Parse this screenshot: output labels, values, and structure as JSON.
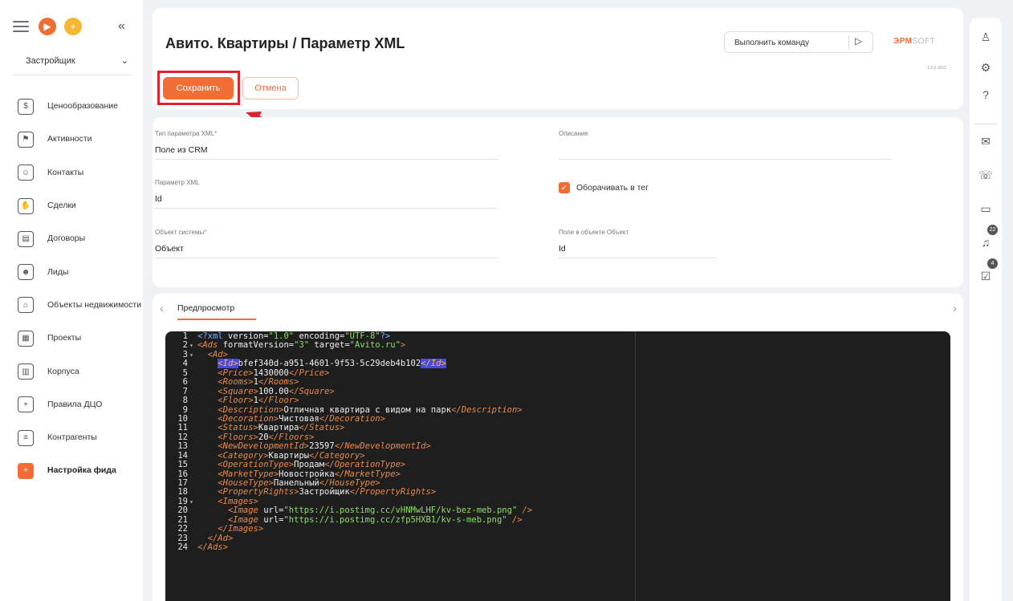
{
  "sidebar": {
    "role_select": "Застройщик",
    "items": [
      {
        "label": "Ценообразование",
        "icon": "pricing-icon",
        "glyph": "$"
      },
      {
        "label": "Активности",
        "icon": "flag-icon",
        "glyph": "⚑"
      },
      {
        "label": "Контакты",
        "icon": "contact-icon",
        "glyph": "☺"
      },
      {
        "label": "Сделки",
        "icon": "handshake-icon",
        "glyph": "✋"
      },
      {
        "label": "Договоры",
        "icon": "contract-icon",
        "glyph": "▤"
      },
      {
        "label": "Лиды",
        "icon": "leads-icon",
        "glyph": "☻"
      },
      {
        "label": "Объекты недвижимости",
        "icon": "property-icon",
        "glyph": "⌂"
      },
      {
        "label": "Проекты",
        "icon": "projects-icon",
        "glyph": "▦"
      },
      {
        "label": "Корпуса",
        "icon": "building-icon",
        "glyph": "▥"
      },
      {
        "label": "Правила ДЦО",
        "icon": "rules-icon",
        "glyph": "+"
      },
      {
        "label": "Контрагенты",
        "icon": "counterparty-icon",
        "glyph": "≡"
      },
      {
        "label": "Настройка фида",
        "icon": "feed-settings-icon",
        "glyph": "+"
      }
    ]
  },
  "header": {
    "title": "Авито. Квартиры / Параметр XML",
    "command_placeholder": "Выполнить команду",
    "logo_main": "ЭРМ",
    "logo_soft": "SOFT",
    "version": "1.2.0.1813",
    "save_label": "Сохранить",
    "cancel_label": "Отмена"
  },
  "form": {
    "xml_param_type": {
      "label": "Тип параметра XML",
      "value": "Поле из CRM"
    },
    "description": {
      "label": "Описание",
      "value": ""
    },
    "xml_param": {
      "label": "Параметр XML",
      "value": "Id"
    },
    "wrap_in_tag": {
      "label": "Оборачивать в тег",
      "checked": true
    },
    "system_object": {
      "label": "Объект системы",
      "value": "Объект"
    },
    "object_field": {
      "label": "Поле в объекте Объект",
      "value": "Id"
    }
  },
  "preview": {
    "tab_label": "Предпросмотр",
    "code_lines": [
      {
        "n": "1",
        "fold": "",
        "parts": [
          [
            "pi",
            "<?xml"
          ],
          [
            "text",
            " version="
          ],
          [
            "str",
            "\"1.0\""
          ],
          [
            "text",
            " encoding="
          ],
          [
            "str",
            "\"UTF-8\""
          ],
          [
            "pi",
            "?>"
          ]
        ]
      },
      {
        "n": "2",
        "fold": "▾",
        "parts": [
          [
            "tag",
            "<Ads"
          ],
          [
            "text",
            " formatVersion="
          ],
          [
            "str",
            "\"3\""
          ],
          [
            "text",
            " target="
          ],
          [
            "str",
            "\"Avito.ru\""
          ],
          [
            "tag",
            ">"
          ]
        ]
      },
      {
        "n": "3",
        "fold": "▾",
        "parts": [
          [
            "text",
            "  "
          ],
          [
            "tag",
            "<Ad>"
          ]
        ]
      },
      {
        "n": "4",
        "fold": "",
        "parts": [
          [
            "text",
            "    "
          ],
          [
            "hl",
            "<Id>"
          ],
          [
            "text",
            "bfef340d-a951-4601-9f53-5c29deb4b102"
          ],
          [
            "hl",
            "</Id>"
          ]
        ]
      },
      {
        "n": "5",
        "fold": "",
        "parts": [
          [
            "text",
            "    "
          ],
          [
            "tag",
            "<Price>"
          ],
          [
            "text",
            "1430000"
          ],
          [
            "tag",
            "</Price>"
          ]
        ]
      },
      {
        "n": "6",
        "fold": "",
        "parts": [
          [
            "text",
            "    "
          ],
          [
            "tag",
            "<Rooms>"
          ],
          [
            "text",
            "1"
          ],
          [
            "tag",
            "</Rooms>"
          ]
        ]
      },
      {
        "n": "7",
        "fold": "",
        "parts": [
          [
            "text",
            "    "
          ],
          [
            "tag",
            "<Square>"
          ],
          [
            "text",
            "100.00"
          ],
          [
            "tag",
            "</Square>"
          ]
        ]
      },
      {
        "n": "8",
        "fold": "",
        "parts": [
          [
            "text",
            "    "
          ],
          [
            "tag",
            "<Floor>"
          ],
          [
            "text",
            "1"
          ],
          [
            "tag",
            "</Floor>"
          ]
        ]
      },
      {
        "n": "9",
        "fold": "",
        "parts": [
          [
            "text",
            "    "
          ],
          [
            "tag",
            "<Description>"
          ],
          [
            "text",
            "Отличная квартира с видом на парк"
          ],
          [
            "tag",
            "</Description>"
          ]
        ]
      },
      {
        "n": "10",
        "fold": "",
        "parts": [
          [
            "text",
            "    "
          ],
          [
            "tag",
            "<Decoration>"
          ],
          [
            "text",
            "Чистовая"
          ],
          [
            "tag",
            "</Decoration>"
          ]
        ]
      },
      {
        "n": "11",
        "fold": "",
        "parts": [
          [
            "text",
            "    "
          ],
          [
            "tag",
            "<Status>"
          ],
          [
            "text",
            "Квартира"
          ],
          [
            "tag",
            "</Status>"
          ]
        ]
      },
      {
        "n": "12",
        "fold": "",
        "parts": [
          [
            "text",
            "    "
          ],
          [
            "tag",
            "<Floors>"
          ],
          [
            "text",
            "20"
          ],
          [
            "tag",
            "</Floors>"
          ]
        ]
      },
      {
        "n": "13",
        "fold": "",
        "parts": [
          [
            "text",
            "    "
          ],
          [
            "tag",
            "<NewDevelopmentId>"
          ],
          [
            "text",
            "23597"
          ],
          [
            "tag",
            "</NewDevelopmentId>"
          ]
        ]
      },
      {
        "n": "14",
        "fold": "",
        "parts": [
          [
            "text",
            "    "
          ],
          [
            "tag",
            "<Category>"
          ],
          [
            "text",
            "Квартиры"
          ],
          [
            "tag",
            "</Category>"
          ]
        ]
      },
      {
        "n": "15",
        "fold": "",
        "parts": [
          [
            "text",
            "    "
          ],
          [
            "tag",
            "<OperationType>"
          ],
          [
            "text",
            "Продам"
          ],
          [
            "tag",
            "</OperationType>"
          ]
        ]
      },
      {
        "n": "16",
        "fold": "",
        "parts": [
          [
            "text",
            "    "
          ],
          [
            "tag",
            "<MarketType>"
          ],
          [
            "text",
            "Новостройка"
          ],
          [
            "tag",
            "</MarketType>"
          ]
        ]
      },
      {
        "n": "17",
        "fold": "",
        "parts": [
          [
            "text",
            "    "
          ],
          [
            "tag",
            "<HouseType>"
          ],
          [
            "text",
            "Панельный"
          ],
          [
            "tag",
            "</HouseType>"
          ]
        ]
      },
      {
        "n": "18",
        "fold": "",
        "parts": [
          [
            "text",
            "    "
          ],
          [
            "tag",
            "<PropertyRights>"
          ],
          [
            "text",
            "Застройщик"
          ],
          [
            "tag",
            "</PropertyRights>"
          ]
        ]
      },
      {
        "n": "19",
        "fold": "▾",
        "parts": [
          [
            "text",
            "    "
          ],
          [
            "tag",
            "<Images>"
          ]
        ]
      },
      {
        "n": "20",
        "fold": "",
        "parts": [
          [
            "text",
            "      "
          ],
          [
            "tag",
            "<Image"
          ],
          [
            "text",
            " url="
          ],
          [
            "str",
            "\"https://i.postimg.cc/vHNMwLHF/kv-bez-meb.png\""
          ],
          [
            "text",
            " "
          ],
          [
            "tag",
            "/>"
          ]
        ]
      },
      {
        "n": "21",
        "fold": "",
        "parts": [
          [
            "text",
            "      "
          ],
          [
            "tag",
            "<Image"
          ],
          [
            "text",
            " url="
          ],
          [
            "str",
            "\"https://i.postimg.cc/zfp5HXB1/kv-s-meb.png\""
          ],
          [
            "text",
            " "
          ],
          [
            "tag",
            "/>"
          ]
        ]
      },
      {
        "n": "22",
        "fold": "",
        "parts": [
          [
            "text",
            "    "
          ],
          [
            "tag",
            "</Images>"
          ]
        ]
      },
      {
        "n": "23",
        "fold": "",
        "parts": [
          [
            "text",
            "  "
          ],
          [
            "tag",
            "</Ad>"
          ]
        ]
      },
      {
        "n": "24",
        "fold": "",
        "parts": [
          [
            "tag",
            "</Ads>"
          ]
        ]
      }
    ]
  },
  "rightbar": {
    "icons": [
      "user-icon",
      "settings-icon",
      "help-icon",
      "mail-icon",
      "chat-icon",
      "message-icon",
      "bell-icon",
      "tasks-icon"
    ],
    "notifications_count": "22",
    "tasks_count": "4"
  },
  "colors": {
    "accent": "#f26d34",
    "highlight_box": "#e2202a",
    "editor_bg": "#1e1e1e"
  }
}
